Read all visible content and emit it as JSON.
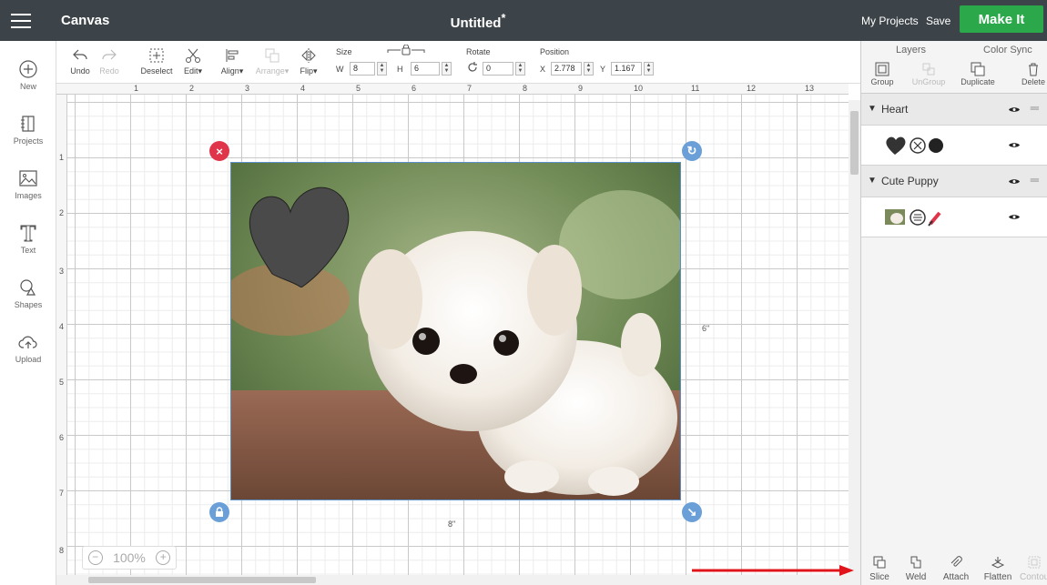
{
  "topbar": {
    "app_title": "Canvas",
    "doc_title": "Untitled",
    "unsaved_marker": "*",
    "my_projects": "My Projects",
    "save": "Save",
    "make_it": "Make It",
    "make_it_color": "#2aa84a"
  },
  "leftbar": {
    "items": [
      {
        "label": "New",
        "icon": "plus-circle-icon"
      },
      {
        "label": "Projects",
        "icon": "book-icon"
      },
      {
        "label": "Images",
        "icon": "image-icon"
      },
      {
        "label": "Text",
        "icon": "text-t-icon"
      },
      {
        "label": "Shapes",
        "icon": "shapes-icon"
      },
      {
        "label": "Upload",
        "icon": "cloud-upload-icon"
      }
    ]
  },
  "toolbar": {
    "undo": "Undo",
    "redo": "Redo",
    "deselect": "Deselect",
    "edit": "Edit",
    "align": "Align",
    "arrange": "Arrange",
    "flip": "Flip",
    "size_label": "Size",
    "w_label": "W",
    "w_value": "8",
    "h_label": "H",
    "h_value": "6",
    "rotate_label": "Rotate",
    "rotate_value": "0",
    "position_label": "Position",
    "x_label": "X",
    "x_value": "2.778",
    "y_label": "Y",
    "y_value": "1.167"
  },
  "ruler": {
    "top": [
      "1",
      "2",
      "3",
      "4",
      "5",
      "6",
      "7",
      "8",
      "9",
      "10",
      "11",
      "12",
      "13"
    ],
    "left": [
      "1",
      "2",
      "3",
      "4",
      "5",
      "6",
      "7",
      "8"
    ]
  },
  "canvas": {
    "width_label": "8\"",
    "height_label": "6\"",
    "zoom_value": "100%",
    "zoom_minus": "−",
    "zoom_plus": "+",
    "delete_handle": "×",
    "rotate_handle": "↻",
    "resize_handle": "↘"
  },
  "rightpanel": {
    "tabs": [
      "Layers",
      "Color Sync"
    ],
    "actions": [
      {
        "label": "Group",
        "enabled": true,
        "icon": "group-icon"
      },
      {
        "label": "UnGroup",
        "enabled": false,
        "icon": "ungroup-icon"
      },
      {
        "label": "Duplicate",
        "enabled": true,
        "icon": "duplicate-icon"
      },
      {
        "label": "Delete",
        "enabled": true,
        "icon": "trash-icon"
      }
    ],
    "layers": [
      {
        "name": "Heart"
      },
      {
        "name": "Cute Puppy"
      }
    ],
    "bottom_actions": [
      {
        "label": "Slice",
        "enabled": true,
        "icon": "slice-icon"
      },
      {
        "label": "Weld",
        "enabled": true,
        "icon": "weld-icon"
      },
      {
        "label": "Attach",
        "enabled": true,
        "icon": "attach-icon"
      },
      {
        "label": "Flatten",
        "enabled": true,
        "icon": "flatten-icon"
      },
      {
        "label": "Contour",
        "enabled": false,
        "icon": "contour-icon"
      }
    ]
  },
  "colors": {
    "topbar": "#3d4449",
    "accent_green": "#2aa84a",
    "delete_red": "#e0344a",
    "handle_blue": "#6a9fd8",
    "heart_gray": "#4a4a4a",
    "annotation_arrow": "#e2141b"
  }
}
